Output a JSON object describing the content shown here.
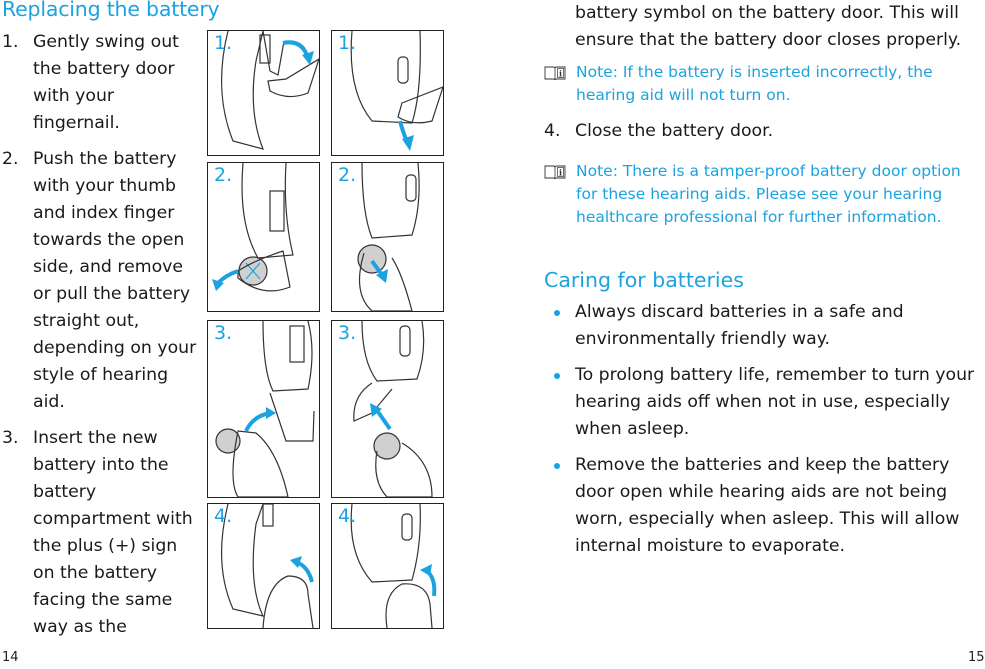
{
  "left_page": {
    "title": "Replacing the battery",
    "steps": [
      {
        "num": "1.",
        "text": "Gently swing out the battery door with your fingernail."
      },
      {
        "num": "2.",
        "text": "Push the battery with your thumb and index finger towards the open side, and remove or pull the battery straight out, depending on your style of hearing aid."
      },
      {
        "num": "3.",
        "text": "Insert the new battery into the battery compartment with the plus (+) sign on the battery facing the same way as the"
      }
    ],
    "illustrations": [
      {
        "label": "1.",
        "description": "Fingernail swinging out battery door (model A)"
      },
      {
        "label": "1.",
        "description": "Fingernail swinging out battery door (model B)"
      },
      {
        "label": "2.",
        "description": "Pushing battery out sideways (model A)"
      },
      {
        "label": "2.",
        "description": "Pulling battery straight out (model B)"
      },
      {
        "label": "3.",
        "description": "Inserting new battery (model A)"
      },
      {
        "label": "3.",
        "description": "Inserting new battery (model B)"
      },
      {
        "label": "4.",
        "description": "Closing battery door with thumb (model A)"
      },
      {
        "label": "4.",
        "description": "Closing battery door with thumb (model B)"
      }
    ],
    "page_number": "14"
  },
  "right_page": {
    "continuation": "battery symbol on the battery door. This will ensure that the battery door closes properly.",
    "note1": "Note: If the battery is inserted incorrectly, the hearing aid will not turn on.",
    "step4": {
      "num": "4.",
      "text": "Close the battery door."
    },
    "note2": "Note: There is a tamper-proof battery door option for these hearing aids. Please see your hearing healthcare professional for further information.",
    "care_title": "Caring for batteries",
    "bullets": [
      "Always discard batteries in a safe and environmentally friendly way.",
      "To prolong battery life, remember to turn your hearing aids off when not in use, especially when asleep.",
      "Remove the batteries and keep the battery door open while hearing aids are not being worn, especially when asleep. This will allow internal moisture to evaporate."
    ],
    "page_number": "15"
  },
  "colors": {
    "accent": "#1aa3e0",
    "text": "#1a1a1a"
  }
}
